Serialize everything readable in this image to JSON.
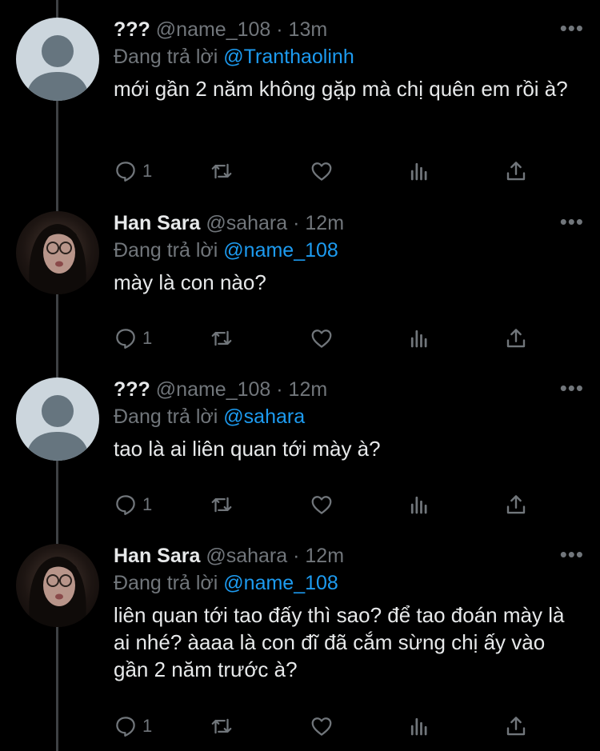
{
  "tweets": [
    {
      "name": "???",
      "handle": "@name_108",
      "sep": "·",
      "time": "13m",
      "replying_prefix": "Đang trả lời",
      "replying_to": "@Tranthaolinh",
      "text": "mới gần 2 năm không gặp mà chị quên em rồi à?",
      "reply_count": "1",
      "avatar": "default"
    },
    {
      "name": "Han Sara",
      "handle": "@sahara",
      "sep": "·",
      "time": "12m",
      "replying_prefix": "Đang trả lời",
      "replying_to": "@name_108",
      "text": "mày là con nào?",
      "reply_count": "1",
      "avatar": "photo"
    },
    {
      "name": "???",
      "handle": "@name_108",
      "sep": "·",
      "time": "12m",
      "replying_prefix": "Đang trả lời",
      "replying_to": "@sahara",
      "text": "tao là ai liên quan tới mày à?",
      "reply_count": "1",
      "avatar": "default"
    },
    {
      "name": "Han Sara",
      "handle": "@sahara",
      "sep": "·",
      "time": "12m",
      "replying_prefix": "Đang trả lời",
      "replying_to": "@name_108",
      "text": "liên quan tới tao đấy thì sao? để tao đoán mày là ai nhé? àaaa là con đĩ đã cắm sừng chị ấy vào gần 2 năm trước à?",
      "reply_count": "1",
      "avatar": "photo"
    }
  ],
  "more_glyph": "•••",
  "icons": [
    "reply-icon",
    "retweet-icon",
    "like-icon",
    "analytics-icon",
    "share-icon"
  ],
  "colors": {
    "background": "#000000",
    "text": "#e7e9ea",
    "muted": "#71767b",
    "link": "#1d9bf0",
    "thread_line": "#3e4144"
  }
}
